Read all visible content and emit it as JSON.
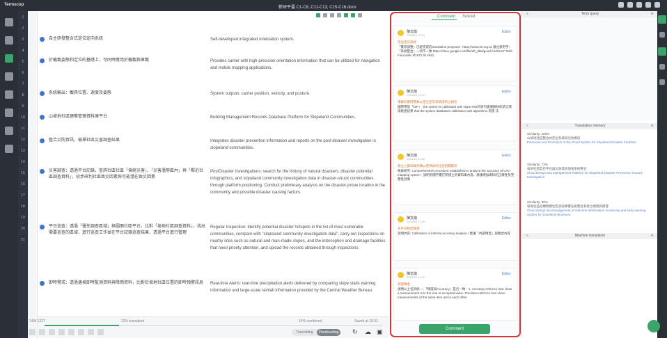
{
  "app": {
    "name": "Termscop",
    "document": "新研平臺 C1-C8, C11-C13, C15-C16.docx"
  },
  "line_numbers": [
    "1",
    "2",
    "3",
    "4",
    "5",
    "6",
    "7",
    "8",
    "9",
    "10",
    "11",
    "12",
    "13",
    "14",
    "15",
    "16",
    "17",
    "18",
    "19",
    "20",
    "21"
  ],
  "segments": [
    {
      "source": "自主研發整合式定位定向系統",
      "target": "Self-developed integrated orientation system."
    },
    {
      "source": "於機載姿態和定位的基礎上，可同時應用於機載與車載",
      "target": "Provides carrier with high-precision orientation information that can be utilized for navigation and mobile mapping applications."
    },
    {
      "source": "系統輸出：載具位置、速度及姿態",
      "target": "System outputs: carrier position, velocity, and posture."
    },
    {
      "source": "山坡地社區建築管理資料庫平台",
      "target": "Building Management Records Database Platform for Slopeland Communities."
    },
    {
      "source": "整合災防資訊，被掃社區災害調查結果",
      "target": "Integrates disaster prevention information and reports on the post disaster investigation in slopeland communities."
    },
    {
      "source": "災害調查：透過平台記錄，查詢社區社區「曾經災害」，「災害潛勢區內」與「鄰近社區調查資料」，初步研判社區致災因素與可能潛在致災因素",
      "target": "PostDisaster Investigations: search for the history of natural disasters, disaster potential infographics, and slopeland community investigation data in disaster-struck communities through platform positioning. Conduct preliminary analysis on the disaster-prone location in the community and possible disaster causing factors."
    },
    {
      "source": "平日巡查：透過「優先調查區域」與圖面社區平台，比對「坡地社區調查資料」，找出需要巡查的區域，進行巡查工作並在平台記錄巡查結果，透過平台進行管理",
      "target": "Regular Inspection: Identify potential disaster hotspots in the list of most vulnerable communities, compare with \"slopeland community investigation data\", carry out inspections on nearby sites such as natural and man-made slopes, and the interception and drainage facilities that need priority attention, and upload the records obtained through inspections."
    },
    {
      "source": "即時警戒：透過邊坡即時監測資料與降雨資料，比對於坡地社區位置的即時預警訊息",
      "target": "Real-time Alerts: real-time precipitation alerts delivered by comparing slope static warning information and large-scale rainfall information provided by the Central Weather Bureau."
    }
  ],
  "toolbar": {
    "words": "14W  1227",
    "percent_translated": "22% translated",
    "percent_confirmed": "14% confirmed",
    "saved": "Saved at 10:31"
  },
  "progress": {
    "translated": 0.22,
    "confirmed": 0.14
  },
  "mode_toggle": {
    "left": "Translating",
    "right": "Proofreading"
  },
  "comments": {
    "tab_comment": "Comment",
    "tab_solved": "Solved",
    "button": "Comment",
    "items": [
      {
        "name": "陳文勛",
        "time": "2023/9/1 10:31",
        "edit": "Editor",
        "quote": "定位定向系統",
        "body": "「雙系調整」已經完成的translation proposal：https://www.itri.org.tw 請注意用字：「系統整合」一詞不一致 https://drive.google.com/file/d/t_dtail/good fordSctvT Rofit Final aafic.tif1972 lib 4541"
      },
      {
        "name": "陳文勛",
        "time": "2023/9/1 10:40",
        "edit": "Editor",
        "quote": "車載的應用需要以定位定向系統提供之資訊",
        "body": "國際用語「NIP」: the system is calibrated with slope limit的語句建議刪除的語言環境檢查結果 that the system databases calibration with algorithms 詞語 法 "
      },
      {
        "name": "陳文勛",
        "time": "2023/9/1 11:05",
        "edit": "Editor",
        "quote": "建立之資料庫架構以提供坡地社區相關資訊",
        "body": "根據研究: Comprehensive procedure established to analyze the accuracy of UAV mapping system ‧ 說明有關平臺在所建立的資料庫內容，建議增加資料的正確性及完整性說明"
      },
      {
        "name": "陳文勛",
        "time": "2023/9/1 11:20",
        "edit": "Editor",
        "quote": "多平台精度驗證",
        "body": "說明內容: Calibration of internal accuracy analysis / 建議「內部精度」與整合內容"
      },
      {
        "name": "陳文勛",
        "time": "2023/9/1 11:42",
        "edit": "Editor",
        "quote": "測量精度",
        "body": "請問以上名詞統一，「精度與Accuracy」是否一致：1. Accuracy refers to how close a measurement is to the true or accepted value. Precision refers to how close measurements of the same item are to each other."
      }
    ]
  },
  "term_query": {
    "title": "Term query"
  },
  "translation_memory": {
    "title": "Translation memory",
    "items": [
      {
        "similarity": "Similarity: 100%",
        "source": "山坡地社區整合式定位系統與災防資訊",
        "target": "Extension and Promotion of the Cloud System for Slopeland Disaster Facilities"
      },
      {
        "similarity": "Similarity: 72%",
        "source": "坡地社區監控平台與災防資訊調查系統整合",
        "target": "Cloud Design and Management Platform for Slopeland Disaster Prevention Hazard Investigation"
      },
      {
        "similarity": "Similarity: 60%",
        "source": "坡地社區結構物變位監測與預警技術整合系統之規劃與開發",
        "target": "Cloud design and management of real-time deformation monitoring and early warning system for slopeland structures"
      }
    ]
  },
  "machine_translation": {
    "title": "Machine translation"
  }
}
